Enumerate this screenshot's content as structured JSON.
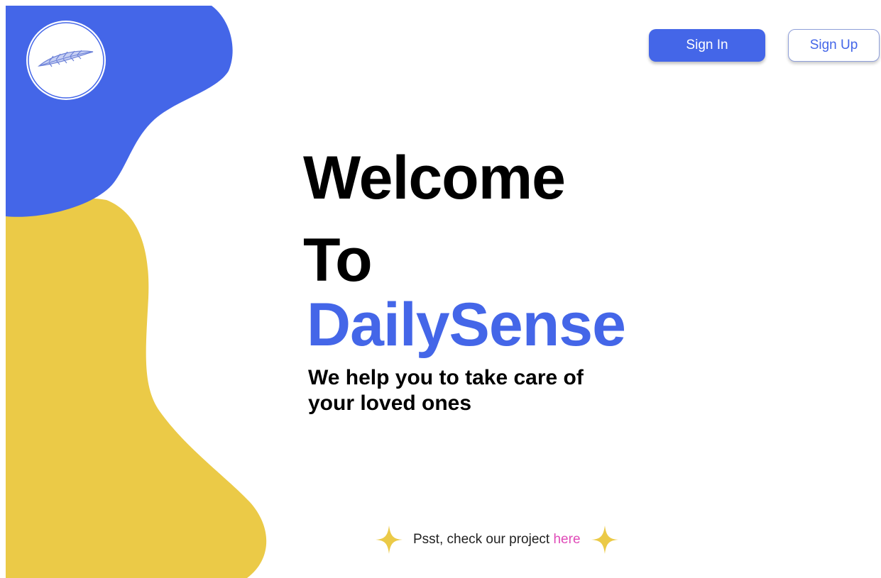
{
  "header": {
    "logo_icon": "feather-icon",
    "signin_label": "Sign In",
    "signup_label": "Sign Up"
  },
  "hero": {
    "line1": "Welcome",
    "line2": "To",
    "brand": "DailySense",
    "tagline": "We help you to take care of your loved ones"
  },
  "footer": {
    "note_text": "Psst, check our project",
    "link_text": "here",
    "sparkle_icon": "sparkle-icon"
  },
  "colors": {
    "brand_blue": "#4466e8",
    "accent_yellow": "#ebca47",
    "link_pink": "#e04bb8"
  }
}
